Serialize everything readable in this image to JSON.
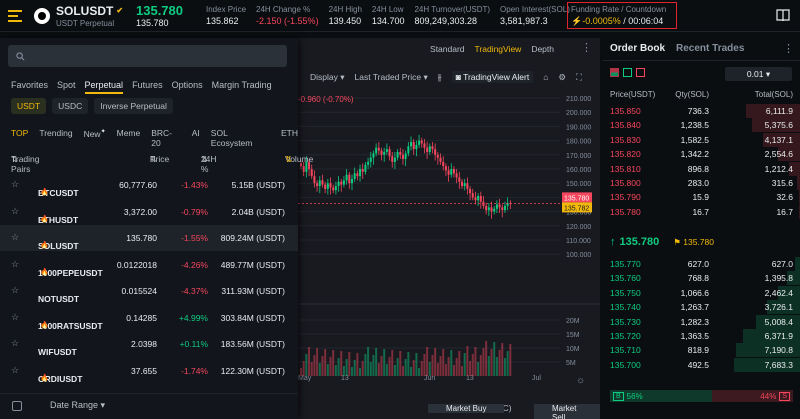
{
  "header": {
    "symbol": "SOLUSDT",
    "symbol_sub": "USDT Perpetual",
    "last_price": "135.780",
    "last_price_sub": "135.780",
    "stats": [
      {
        "label": "Index Price",
        "value": "135.862",
        "tone": "plain"
      },
      {
        "label": "24H Change %",
        "value": "-2.150 (-1.55%)",
        "tone": "red"
      },
      {
        "label": "24H High",
        "value": "139.450",
        "tone": "plain"
      },
      {
        "label": "24H Low",
        "value": "134.700",
        "tone": "plain"
      },
      {
        "label": "24H Turnover(USDT)",
        "value": "809,249,303.28",
        "tone": "plain"
      },
      {
        "label": "Open Interest(SOL)",
        "value": "3,581,987.3",
        "tone": "plain"
      }
    ],
    "funding_label": "Funding Rate / Countdown",
    "funding_rate": "-0.0005%",
    "countdown": "00:06:04"
  },
  "market": {
    "search_placeholder": "",
    "categories": [
      "Favorites",
      "Spot",
      "Perpetual",
      "Futures",
      "Options",
      "Margin Trading"
    ],
    "active_category": "Perpetual",
    "quote_tabs": [
      "USDT",
      "USDC",
      "Inverse Perpetual"
    ],
    "sub_tabs": [
      "TOP",
      "Trending",
      "New",
      "Meme",
      "BRC-20",
      "AI",
      "SOL Ecosystem",
      "ETH"
    ],
    "columns": {
      "pair": "Trading Pairs",
      "price": "Price",
      "change": "24H %",
      "volume": "Volume"
    },
    "pairs": [
      {
        "symbol": "BTCUSDT",
        "price": "60,777.60",
        "change": "-1.43%",
        "dir": "red",
        "volume": "5.15B (USDT)",
        "hot": true
      },
      {
        "symbol": "ETHUSDT",
        "price": "3,372.00",
        "change": "-0.79%",
        "dir": "red",
        "volume": "2.04B (USDT)",
        "hot": true
      },
      {
        "symbol": "SOLUSDT",
        "price": "135.780",
        "change": "-1.55%",
        "dir": "red",
        "volume": "809.24M (USDT)",
        "hot": true
      },
      {
        "symbol": "1000PEPEUSDT",
        "price": "0.0122018",
        "change": "-4.26%",
        "dir": "red",
        "volume": "489.77M (USDT)",
        "hot": true
      },
      {
        "symbol": "NOTUSDT",
        "price": "0.015524",
        "change": "-4.37%",
        "dir": "red",
        "volume": "311.93M (USDT)",
        "hot": false
      },
      {
        "symbol": "1000RATSUSDT",
        "price": "0.14285",
        "change": "+4.99%",
        "dir": "green",
        "volume": "303.84M (USDT)",
        "hot": true
      },
      {
        "symbol": "WIFUSDT",
        "price": "2.0398",
        "change": "+0.11%",
        "dir": "green",
        "volume": "183.56M (USDT)",
        "hot": false
      },
      {
        "symbol": "ORDIUSDT",
        "price": "37.655",
        "change": "-1.74%",
        "dir": "red",
        "volume": "122.30M (USDT)",
        "hot": true
      }
    ],
    "date_range_label": "Date Range"
  },
  "chart": {
    "view_tabs": [
      "Standard",
      "TradingView",
      "Depth"
    ],
    "active_view": "TradingView",
    "toolbar": {
      "display": "Display",
      "price_type": "Last Traded Price",
      "alert": "TradingView Alert"
    },
    "change_label": "-0.960 (-0.70%)",
    "price_ticks": [
      "210.000",
      "200.000",
      "190.000",
      "180.000",
      "170.000",
      "160.000",
      "150.000",
      "140.000",
      "130.000",
      "120.000",
      "110.000",
      "100.000"
    ],
    "volume_ticks": [
      "20M",
      "15M",
      "10M",
      "5M"
    ],
    "last_tag": "135.780",
    "last_tag2": "135.782",
    "time_ticks": [
      "May",
      "13",
      "Jun",
      "13",
      "Jul"
    ],
    "clock": "07:53:57 (UTC)",
    "bottom": {
      "percent": "%",
      "log": "log",
      "auto": "auto"
    },
    "market_buy": "Market Buy",
    "market_sell": "Market Sell"
  },
  "orderbook": {
    "tabs": [
      "Order Book",
      "Recent Trades"
    ],
    "tick": "0.01",
    "columns": {
      "price": "Price(USDT)",
      "qty": "Qty(SOL)",
      "total": "Total(SOL)"
    },
    "asks": [
      {
        "price": "135.850",
        "qty": "736.3",
        "total": "6,111.9",
        "depth": 0.82
      },
      {
        "price": "135.840",
        "qty": "1,238.5",
        "total": "5,375.6",
        "depth": 0.72
      },
      {
        "price": "135.830",
        "qty": "1,582.5",
        "total": "4,137.1",
        "depth": 0.56
      },
      {
        "price": "135.820",
        "qty": "1,342.2",
        "total": "2,554.6",
        "depth": 0.34
      },
      {
        "price": "135.810",
        "qty": "896.8",
        "total": "1,212.4",
        "depth": 0.17
      },
      {
        "price": "135.800",
        "qty": "283.0",
        "total": "315.6",
        "depth": 0.05
      },
      {
        "price": "135.790",
        "qty": "15.9",
        "total": "32.6",
        "depth": 0.01
      },
      {
        "price": "135.780",
        "qty": "16.7",
        "total": "16.7",
        "depth": 0.01
      }
    ],
    "mid_price": "135.780",
    "mark_price": "135.780",
    "bids": [
      {
        "price": "135.770",
        "qty": "627.0",
        "total": "627.0",
        "depth": 0.08
      },
      {
        "price": "135.760",
        "qty": "768.8",
        "total": "1,395.8",
        "depth": 0.19
      },
      {
        "price": "135.750",
        "qty": "1,066.6",
        "total": "2,462.4",
        "depth": 0.33
      },
      {
        "price": "135.740",
        "qty": "1,263.7",
        "total": "3,726.1",
        "depth": 0.5
      },
      {
        "price": "135.730",
        "qty": "1,282.3",
        "total": "5,008.4",
        "depth": 0.67
      },
      {
        "price": "135.720",
        "qty": "1,363.5",
        "total": "6,371.9",
        "depth": 0.86
      },
      {
        "price": "135.710",
        "qty": "818.9",
        "total": "7,190.8",
        "depth": 0.97
      },
      {
        "price": "135.700",
        "qty": "492.5",
        "total": "7,683.3",
        "depth": 1.0
      }
    ],
    "buy_label": "B",
    "buy_pct": "56%",
    "sell_label": "S",
    "sell_pct": "44%",
    "buy_ratio": 0.56
  },
  "colors": {
    "up": "#0ecb81",
    "down": "#f6465d",
    "accent": "#f0b90b",
    "highlight_border": "#e0242d"
  }
}
